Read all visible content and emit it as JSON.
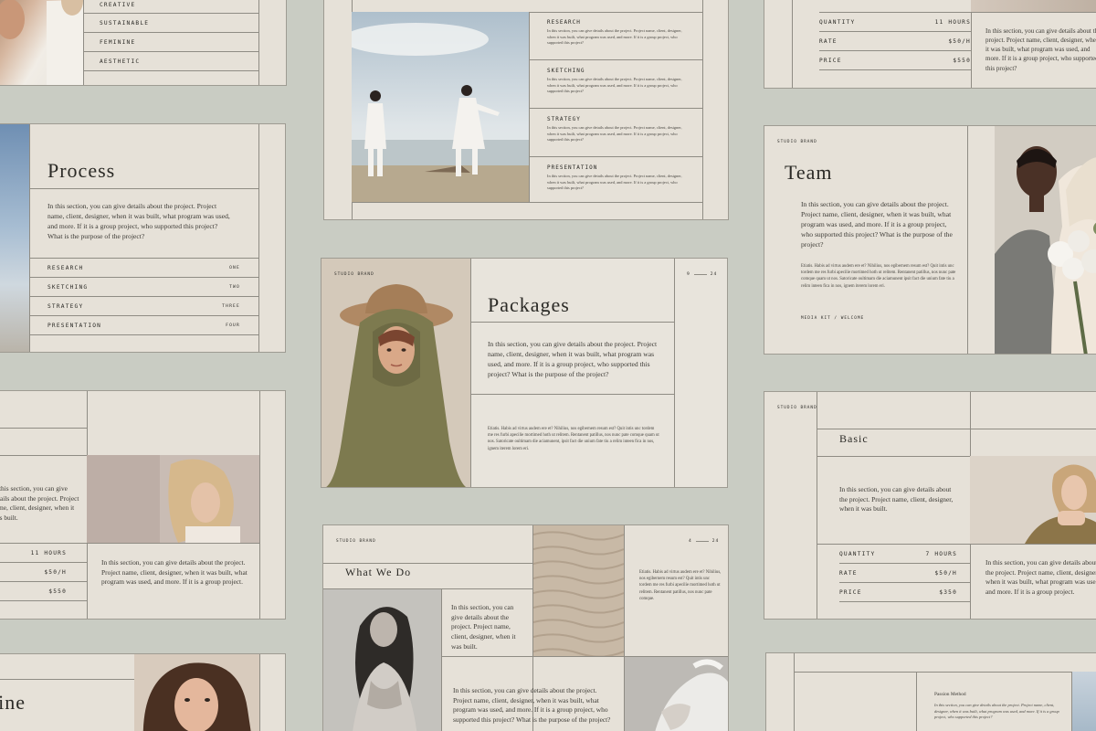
{
  "slides": {
    "topleft_values": {
      "items": [
        "Creative",
        "Sustainable",
        "Feminine",
        "Aesthetic"
      ]
    },
    "process": {
      "title": "Process",
      "body": "In this section, you can give details about the project. Project name, client, designer, when it was built, what program was used, and more. If it is a group project, who supported this project? What is the purpose of the project?",
      "rows": [
        {
          "label": "Research",
          "num": "One"
        },
        {
          "label": "Sketching",
          "num": "Two"
        },
        {
          "label": "Strategy",
          "num": "Three"
        },
        {
          "label": "Presentation",
          "num": "Four"
        }
      ]
    },
    "top_center": {
      "sections": [
        {
          "label": "Research",
          "text": "In this section, you can give details about the project. Project name, client, designer, when it was built, what program was used, and more. If it is a group project, who supported this project?"
        },
        {
          "label": "Sketching",
          "text": "In this section, you can give details about the project. Project name, client, designer, when it was built, what program was used, and more. If it is a group project, who supported this project?"
        },
        {
          "label": "Strategy",
          "text": "In this section, you can give details about the project. Project name, client, designer, when it was built, what program was used, and more. If it is a group project, who supported this project?"
        },
        {
          "label": "Presentation",
          "text": "In this section, you can give details about the project. Project name, client, designer, when it was built, what program was used, and more. If it is a group project, who supported this project?"
        }
      ]
    },
    "top_right": {
      "rows": [
        {
          "label": "Quantity",
          "value": "11 Hours"
        },
        {
          "label": "Rate",
          "value": "$50/H"
        },
        {
          "label": "Price",
          "value": "$550"
        }
      ],
      "body": "In this section, you can give details about the project. Project name, client, designer, when it was built, what program was used, and more. If it is a group project, who supported this project?"
    },
    "packages": {
      "brand": "Studio Brand",
      "page": "9",
      "total": "24",
      "title": "Packages",
      "body": "In this section, you can give details about the project. Project name, client, designer, when it was built, what program was used, and more. If it is a group project, who supported this project? What is the purpose of the project?",
      "latin": "Etiatis. Habis ad virtus audem ere et? Nihilius, nos egibernem resum est? Quit intis unc tordem me res furbi apecilie mortimed hoth ut relitem. Rentanent patillus, nos nunc pate comque quam ut nos. Satoricate oultimam die aciamunent, ipsit fact die unium fate tiu a relim inteen fica in nos, ignem iterem lorem eri."
    },
    "team": {
      "brand": "Studio Brand",
      "title": "Team",
      "body": "In this section, you can give details about the project. Project name, client, designer, when it was built, what program was used, and more. If it is a group project, who supported this project? What is the purpose of the project?",
      "latin": "Etiatis. Habis ad virtus audem ere et? Nihilius, nos egibernem resum est? Quit intis unc tordem me res furbi apecilie mortimed hoth ut relitem. Rentanent patillus, nos nunc pate comque quam ut nos. Satoricate oultimam die aciamunent ipsit fact die unium fate tiu a relim inteen fica in nos, ignem iterem lorem eri.",
      "footer": "Media Kit / Welcome"
    },
    "mid_left": {
      "body_short": "In this section, you can give details about the project. Project name, client, designer, when it was built.",
      "body_long": "In this section, you can give details about the project. Project name, client, designer, when it was built, what program was used, and more. If it is a group project.",
      "rows": [
        {
          "value": "11 Hours"
        },
        {
          "value": "$50/H"
        },
        {
          "value": "$550"
        }
      ]
    },
    "basic": {
      "brand": "Studio Brand",
      "title": "Basic",
      "body_short": "In this section, you can give details about the project. Project name, client, designer, when it was built.",
      "body_long": "In this section, you can give details about the project. Project name, client, designer, when it was built, what program was used, and more. If it is a group project.",
      "rows": [
        {
          "label": "Quantity",
          "value": "7 Hours"
        },
        {
          "label": "Rate",
          "value": "$50/H"
        },
        {
          "label": "Price",
          "value": "$350"
        }
      ]
    },
    "whatwedo": {
      "brand": "Studio Brand",
      "page": "4",
      "total": "24",
      "title": "What We Do",
      "body_short": "In this section, you can give details about the project. Project name, client, designer, when it was built.",
      "body_long": "In this section, you can give details about the project. Project name, client, designer, when it was built, what program was used, and more. If it is a group project, who supported this project? What is the purpose of the project?",
      "latin": "Etiatis. Habis ad virtus audem ere et? Nihilius, nos egibernem resum est? Quit intis unc tordem me res furbi apecilie mortimed hoth ut relitem. Rentanent patillus, nos nunc pate comque."
    },
    "bottom_left": {
      "title_fragment": "line"
    },
    "bottom_right": {
      "title": "Passion Method",
      "body": "In this section, you can give details about the project. Project name, client, designer, when it was built, what program was used, and more. If it is a group project, who supported this project?"
    }
  },
  "colors": {
    "background": "#c9ccc3",
    "paper": "#e6e1d8",
    "rule": "#8f8c84",
    "ink": "#2b2a26"
  }
}
